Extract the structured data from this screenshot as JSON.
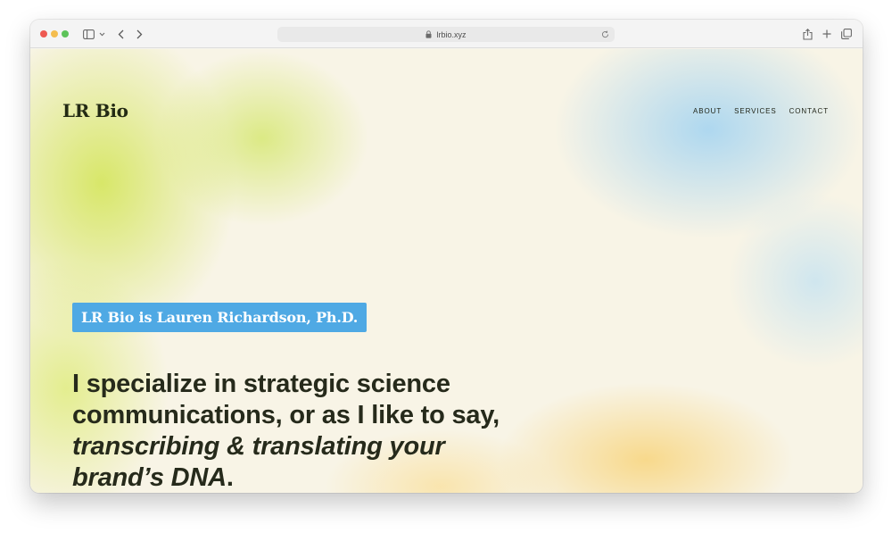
{
  "browser": {
    "url": "lrbio.xyz"
  },
  "site": {
    "logo": "LR Bio",
    "nav": [
      {
        "label": "ABOUT"
      },
      {
        "label": "SERVICES"
      },
      {
        "label": "CONTACT"
      }
    ]
  },
  "hero": {
    "tagline": "LR Bio is Lauren Richardson, Ph.D.",
    "headline_plain_1": "I specialize in strategic science",
    "headline_plain_2": "communications, or as I like to say,",
    "headline_italic_1": "transcribing & translating your",
    "headline_italic_2": "brand’s DNA",
    "headline_end": "."
  },
  "colors": {
    "tag_background": "#4fa9e4",
    "text_dark": "#262a1b",
    "blob_green": "#d6e662",
    "blob_blue": "#aad6f0",
    "blob_yellow": "#f8d682"
  }
}
